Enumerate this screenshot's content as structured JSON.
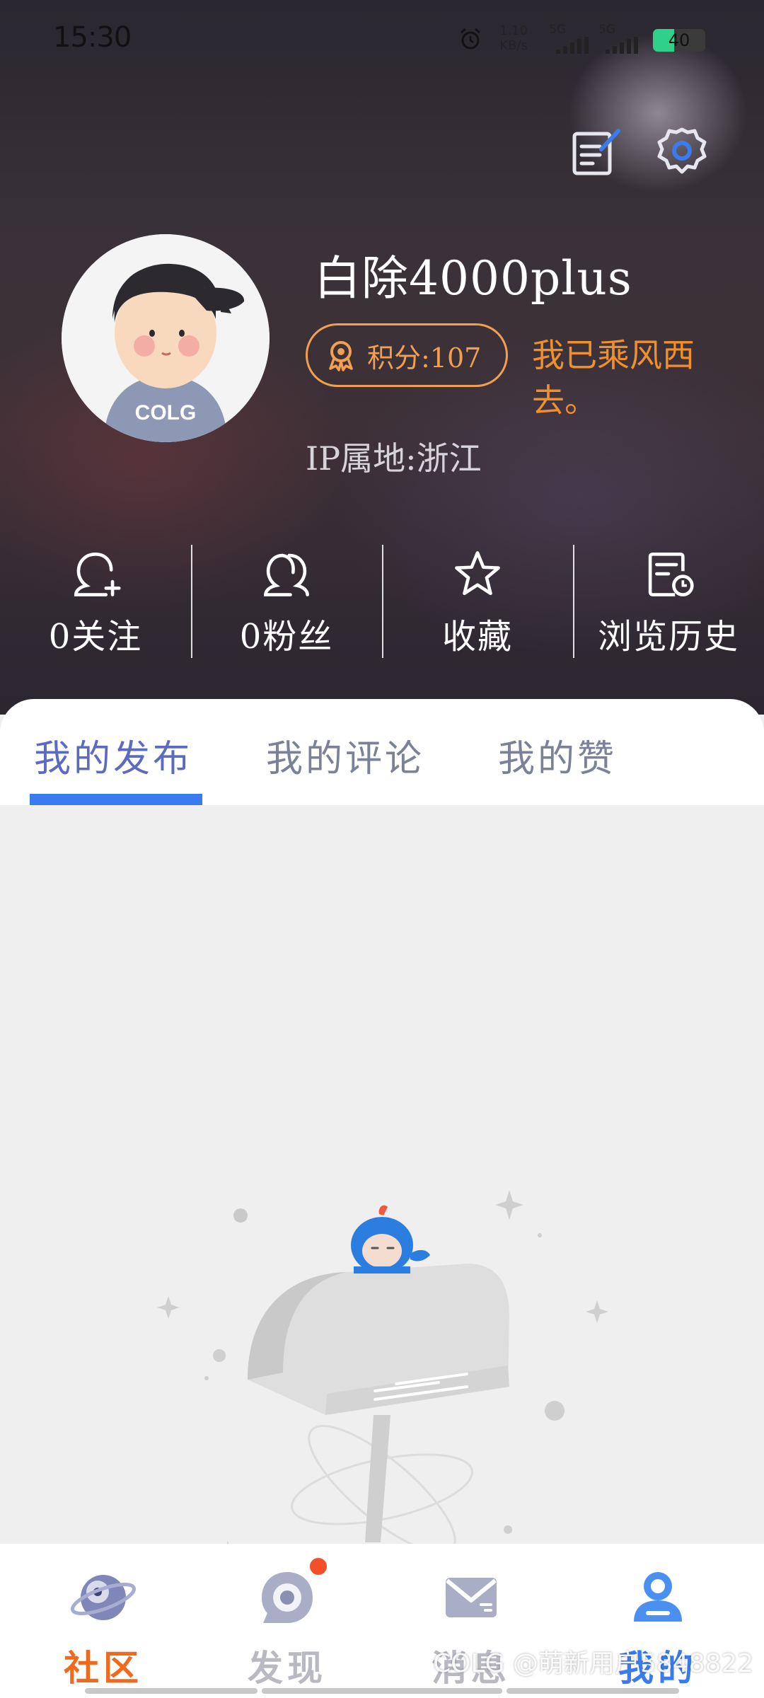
{
  "status_bar": {
    "time": "15:30",
    "net_speed_value": "1.10",
    "net_speed_unit": "KB/s",
    "signal1_label": "5G",
    "signal2_label": "5G",
    "battery_level": "40",
    "battery_fraction": 0.4,
    "battery_color": "#2fd08a"
  },
  "header": {
    "edit_icon": "edit-note-icon",
    "settings_icon": "gear-icon"
  },
  "profile": {
    "username": "白除4000plus",
    "points_label": "积分:107",
    "signature": "我已乘风西去。",
    "ip_location": "IP属地:浙江",
    "avatar_text": "COLG"
  },
  "stats": [
    {
      "label": "0关注",
      "icon": "user-add-icon"
    },
    {
      "label": "0粉丝",
      "icon": "users-icon"
    },
    {
      "label": "收藏",
      "icon": "star-icon"
    },
    {
      "label": "浏览历史",
      "icon": "history-icon"
    }
  ],
  "tabs": [
    {
      "label": "我的发布",
      "active": true
    },
    {
      "label": "我的评论",
      "active": false
    },
    {
      "label": "我的赞",
      "active": false
    }
  ],
  "bottom_nav": [
    {
      "label": "社区",
      "icon": "planet-icon",
      "active": false,
      "color": "#f06a1e"
    },
    {
      "label": "发现",
      "icon": "discover-icon",
      "active": false,
      "has_dot": true
    },
    {
      "label": "消息",
      "icon": "mail-icon",
      "active": false
    },
    {
      "label": "我的",
      "icon": "profile-icon",
      "active": true,
      "color": "#3a7cf0"
    }
  ],
  "watermark": "COLG @萌新用户5848822",
  "colors": {
    "accent": "#3a7cf0",
    "points_orange": "#f0a050",
    "community_orange": "#f06a1e"
  }
}
